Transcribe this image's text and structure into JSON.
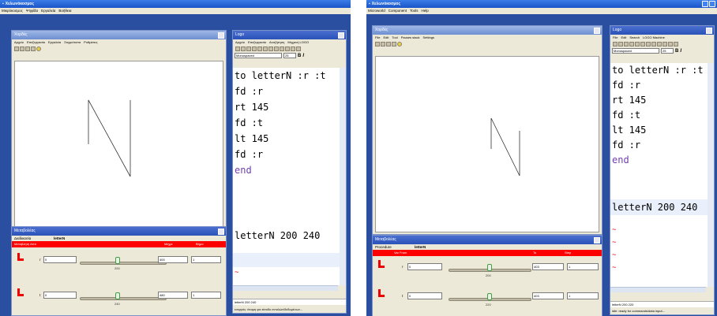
{
  "screens": [
    {
      "app_title": "Χελωνόκοσμος",
      "menu": [
        "Μικρόκοσμος",
        "Ψηφίδα",
        "Εργαλεία",
        "Βοήθεια"
      ],
      "turtle_window": {
        "title": "Χορδές",
        "menu": [
          "Αρχείο",
          "Επεξεργασία",
          "Εργαλεία",
          "Στιγμιότυπα",
          "Ρυθμίσεις"
        ]
      },
      "logo_window": {
        "title": "Logo",
        "menu": [
          "Αρχείο",
          "Επεξεργασία",
          "Αναζήτηση",
          "Μηχανή LOGO"
        ],
        "font_name": "Monospaced",
        "font_size": "25",
        "bold_label": "B",
        "italic_label": "I",
        "code_lines": [
          "to letterN :r :t",
          "fd :r",
          "rt 145",
          "fd :t",
          "lt 145",
          "fd :r",
          "end"
        ],
        "command": "letterN 200 240",
        "command_history": "letterN 200 240",
        "status": "ενεργός: έτοιμη για είσοδο εντολών/δεδομένων...",
        "tilde": "~"
      },
      "variation_window": {
        "title": "Μεταβολέας",
        "procedure_label": "Διαδικασία",
        "procedure_name": "letterN",
        "col_var_from": "Μεταβλητή  Από",
        "col_to": "Μέχρι",
        "col_step": "Βήμα",
        "rows": [
          {
            "var": "r",
            "from": "0",
            "value": "200",
            "to": "400",
            "step": "1"
          },
          {
            "var": "t",
            "from": "0",
            "value": "240",
            "to": "480",
            "step": "1"
          }
        ]
      }
    },
    {
      "app_title": "Χελωνόκοσμος",
      "menu": [
        "Microworld",
        "Component",
        "Tools",
        "Help"
      ],
      "turtle_window": {
        "title": "Χορδές",
        "menu": [
          "File",
          "Edit",
          "Tool",
          "Pauses stack",
          "Settings"
        ]
      },
      "logo_window": {
        "title": "Logo",
        "menu": [
          "File",
          "Edit",
          "Search",
          "LOGO Machine"
        ],
        "font_name": "Monospaced",
        "font_size": "25",
        "bold_label": "B",
        "italic_label": "I",
        "code_lines": [
          "to letterN :r :t",
          "fd :r",
          "rt 145",
          "fd :t",
          "lt 145",
          "fd :r",
          "end"
        ],
        "command": "letterN 200 240",
        "command_history": "letterN 200 220",
        "status": "idle: ready for commands/data input...",
        "tilde": "~"
      },
      "variation_window": {
        "title": "Μεταβολέας",
        "procedure_label": "Procedure",
        "procedure_name": "letterN",
        "col_var_from": "Var  From",
        "col_to": "To",
        "col_step": "Step",
        "rows": [
          {
            "var": "r",
            "from": "0",
            "value": "200",
            "to": "403",
            "step": "1"
          },
          {
            "var": "t",
            "from": "0",
            "value": "220",
            "to": "403",
            "step": "1"
          }
        ]
      }
    }
  ],
  "colors": {
    "desktop": "#2a4ea0",
    "header_bar": "#ff0000",
    "end_keyword": "#6f3fb0"
  }
}
